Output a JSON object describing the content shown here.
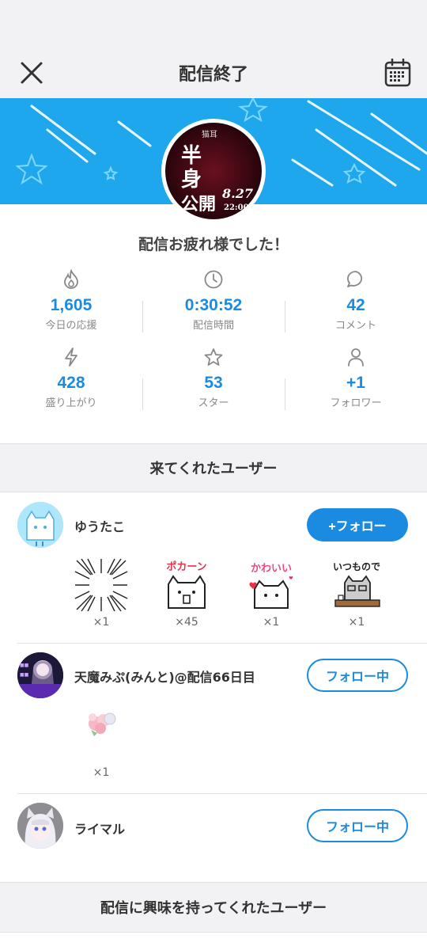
{
  "header": {
    "title": "配信終了"
  },
  "banner": {
    "thumb_text_main": "半身公開",
    "thumb_text_top": "猫耳",
    "thumb_date": "8.27",
    "thumb_time": "22:00"
  },
  "summary": {
    "message": "配信お疲れ様でした！"
  },
  "stats": [
    {
      "icon": "flame-icon",
      "value": "1,605",
      "label": "今日の応援"
    },
    {
      "icon": "clock-icon",
      "value": "0:30:52",
      "label": "配信時間"
    },
    {
      "icon": "comment-icon",
      "value": "42",
      "label": "コメント"
    },
    {
      "icon": "bolt-icon",
      "value": "428",
      "label": "盛り上がり"
    },
    {
      "icon": "star-icon",
      "value": "53",
      "label": "スター"
    },
    {
      "icon": "person-icon",
      "value": "+1",
      "label": "フォロワー"
    }
  ],
  "sections": {
    "visitors_title": "来てくれたユーザー",
    "interested_title": "配信に興味を持ってくれたユーザー"
  },
  "users": [
    {
      "name": "ゆうたこ",
      "button": "+フォロー",
      "gifts": [
        {
          "icon": "burst-gift-icon",
          "count": "×1"
        },
        {
          "icon": "pokan-cat-gift-icon",
          "count": "×45",
          "text": "ポカーン"
        },
        {
          "icon": "kawaii-cat-gift-icon",
          "count": "×1",
          "text": "かわいい"
        },
        {
          "icon": "itsumono-cat-gift-icon",
          "count": "×1",
          "text": "いつもので"
        }
      ]
    },
    {
      "name": "天魔みぷ(みんと)@配信66日目",
      "button": "フォロー中",
      "gifts": [
        {
          "icon": "flower-bouquet-gift-icon",
          "count": "×1"
        }
      ]
    },
    {
      "name": "ライマル",
      "button": "フォロー中",
      "gifts": []
    }
  ],
  "colors": {
    "accent": "#1a8be0",
    "banner": "#1ea7ec",
    "section_bg": "#f2f2f4"
  }
}
